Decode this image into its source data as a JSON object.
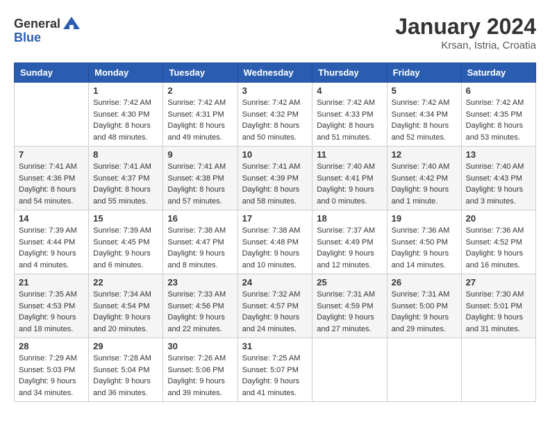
{
  "header": {
    "logo_general": "General",
    "logo_blue": "Blue",
    "title": "January 2024",
    "subtitle": "Krsan, Istria, Croatia"
  },
  "calendar": {
    "weekdays": [
      "Sunday",
      "Monday",
      "Tuesday",
      "Wednesday",
      "Thursday",
      "Friday",
      "Saturday"
    ],
    "weeks": [
      [
        {
          "day": "",
          "sunrise": "",
          "sunset": "",
          "daylight": ""
        },
        {
          "day": "1",
          "sunrise": "Sunrise: 7:42 AM",
          "sunset": "Sunset: 4:30 PM",
          "daylight": "Daylight: 8 hours and 48 minutes."
        },
        {
          "day": "2",
          "sunrise": "Sunrise: 7:42 AM",
          "sunset": "Sunset: 4:31 PM",
          "daylight": "Daylight: 8 hours and 49 minutes."
        },
        {
          "day": "3",
          "sunrise": "Sunrise: 7:42 AM",
          "sunset": "Sunset: 4:32 PM",
          "daylight": "Daylight: 8 hours and 50 minutes."
        },
        {
          "day": "4",
          "sunrise": "Sunrise: 7:42 AM",
          "sunset": "Sunset: 4:33 PM",
          "daylight": "Daylight: 8 hours and 51 minutes."
        },
        {
          "day": "5",
          "sunrise": "Sunrise: 7:42 AM",
          "sunset": "Sunset: 4:34 PM",
          "daylight": "Daylight: 8 hours and 52 minutes."
        },
        {
          "day": "6",
          "sunrise": "Sunrise: 7:42 AM",
          "sunset": "Sunset: 4:35 PM",
          "daylight": "Daylight: 8 hours and 53 minutes."
        }
      ],
      [
        {
          "day": "7",
          "sunrise": "Sunrise: 7:41 AM",
          "sunset": "Sunset: 4:36 PM",
          "daylight": "Daylight: 8 hours and 54 minutes."
        },
        {
          "day": "8",
          "sunrise": "Sunrise: 7:41 AM",
          "sunset": "Sunset: 4:37 PM",
          "daylight": "Daylight: 8 hours and 55 minutes."
        },
        {
          "day": "9",
          "sunrise": "Sunrise: 7:41 AM",
          "sunset": "Sunset: 4:38 PM",
          "daylight": "Daylight: 8 hours and 57 minutes."
        },
        {
          "day": "10",
          "sunrise": "Sunrise: 7:41 AM",
          "sunset": "Sunset: 4:39 PM",
          "daylight": "Daylight: 8 hours and 58 minutes."
        },
        {
          "day": "11",
          "sunrise": "Sunrise: 7:40 AM",
          "sunset": "Sunset: 4:41 PM",
          "daylight": "Daylight: 9 hours and 0 minutes."
        },
        {
          "day": "12",
          "sunrise": "Sunrise: 7:40 AM",
          "sunset": "Sunset: 4:42 PM",
          "daylight": "Daylight: 9 hours and 1 minute."
        },
        {
          "day": "13",
          "sunrise": "Sunrise: 7:40 AM",
          "sunset": "Sunset: 4:43 PM",
          "daylight": "Daylight: 9 hours and 3 minutes."
        }
      ],
      [
        {
          "day": "14",
          "sunrise": "Sunrise: 7:39 AM",
          "sunset": "Sunset: 4:44 PM",
          "daylight": "Daylight: 9 hours and 4 minutes."
        },
        {
          "day": "15",
          "sunrise": "Sunrise: 7:39 AM",
          "sunset": "Sunset: 4:45 PM",
          "daylight": "Daylight: 9 hours and 6 minutes."
        },
        {
          "day": "16",
          "sunrise": "Sunrise: 7:38 AM",
          "sunset": "Sunset: 4:47 PM",
          "daylight": "Daylight: 9 hours and 8 minutes."
        },
        {
          "day": "17",
          "sunrise": "Sunrise: 7:38 AM",
          "sunset": "Sunset: 4:48 PM",
          "daylight": "Daylight: 9 hours and 10 minutes."
        },
        {
          "day": "18",
          "sunrise": "Sunrise: 7:37 AM",
          "sunset": "Sunset: 4:49 PM",
          "daylight": "Daylight: 9 hours and 12 minutes."
        },
        {
          "day": "19",
          "sunrise": "Sunrise: 7:36 AM",
          "sunset": "Sunset: 4:50 PM",
          "daylight": "Daylight: 9 hours and 14 minutes."
        },
        {
          "day": "20",
          "sunrise": "Sunrise: 7:36 AM",
          "sunset": "Sunset: 4:52 PM",
          "daylight": "Daylight: 9 hours and 16 minutes."
        }
      ],
      [
        {
          "day": "21",
          "sunrise": "Sunrise: 7:35 AM",
          "sunset": "Sunset: 4:53 PM",
          "daylight": "Daylight: 9 hours and 18 minutes."
        },
        {
          "day": "22",
          "sunrise": "Sunrise: 7:34 AM",
          "sunset": "Sunset: 4:54 PM",
          "daylight": "Daylight: 9 hours and 20 minutes."
        },
        {
          "day": "23",
          "sunrise": "Sunrise: 7:33 AM",
          "sunset": "Sunset: 4:56 PM",
          "daylight": "Daylight: 9 hours and 22 minutes."
        },
        {
          "day": "24",
          "sunrise": "Sunrise: 7:32 AM",
          "sunset": "Sunset: 4:57 PM",
          "daylight": "Daylight: 9 hours and 24 minutes."
        },
        {
          "day": "25",
          "sunrise": "Sunrise: 7:31 AM",
          "sunset": "Sunset: 4:59 PM",
          "daylight": "Daylight: 9 hours and 27 minutes."
        },
        {
          "day": "26",
          "sunrise": "Sunrise: 7:31 AM",
          "sunset": "Sunset: 5:00 PM",
          "daylight": "Daylight: 9 hours and 29 minutes."
        },
        {
          "day": "27",
          "sunrise": "Sunrise: 7:30 AM",
          "sunset": "Sunset: 5:01 PM",
          "daylight": "Daylight: 9 hours and 31 minutes."
        }
      ],
      [
        {
          "day": "28",
          "sunrise": "Sunrise: 7:29 AM",
          "sunset": "Sunset: 5:03 PM",
          "daylight": "Daylight: 9 hours and 34 minutes."
        },
        {
          "day": "29",
          "sunrise": "Sunrise: 7:28 AM",
          "sunset": "Sunset: 5:04 PM",
          "daylight": "Daylight: 9 hours and 36 minutes."
        },
        {
          "day": "30",
          "sunrise": "Sunrise: 7:26 AM",
          "sunset": "Sunset: 5:06 PM",
          "daylight": "Daylight: 9 hours and 39 minutes."
        },
        {
          "day": "31",
          "sunrise": "Sunrise: 7:25 AM",
          "sunset": "Sunset: 5:07 PM",
          "daylight": "Daylight: 9 hours and 41 minutes."
        },
        {
          "day": "",
          "sunrise": "",
          "sunset": "",
          "daylight": ""
        },
        {
          "day": "",
          "sunrise": "",
          "sunset": "",
          "daylight": ""
        },
        {
          "day": "",
          "sunrise": "",
          "sunset": "",
          "daylight": ""
        }
      ]
    ]
  }
}
